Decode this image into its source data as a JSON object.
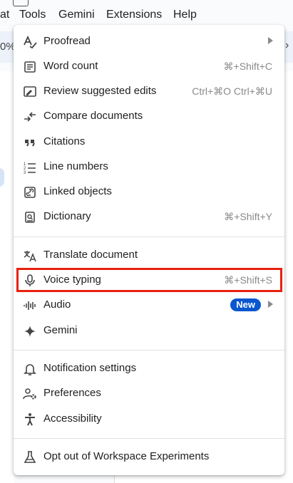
{
  "menubar": {
    "items": [
      {
        "label": "at"
      },
      {
        "label": "Tools"
      },
      {
        "label": "Gemini"
      },
      {
        "label": "Extensions"
      },
      {
        "label": "Help"
      }
    ]
  },
  "background": {
    "zoom_fragment": "0%",
    "chevron": "›"
  },
  "menu": {
    "items": [
      {
        "label": "Proofread",
        "shortcut": "",
        "icon": "proofread-icon",
        "submenu": true
      },
      {
        "label": "Word count",
        "shortcut": "⌘+Shift+C",
        "icon": "word-count-icon"
      },
      {
        "label": "Review suggested edits",
        "shortcut": "Ctrl+⌘O Ctrl+⌘U",
        "icon": "review-edits-icon"
      },
      {
        "label": "Compare documents",
        "shortcut": "",
        "icon": "compare-icon"
      },
      {
        "label": "Citations",
        "shortcut": "",
        "icon": "citations-icon"
      },
      {
        "label": "Line numbers",
        "shortcut": "",
        "icon": "line-numbers-icon"
      },
      {
        "label": "Linked objects",
        "shortcut": "",
        "icon": "linked-objects-icon"
      },
      {
        "label": "Dictionary",
        "shortcut": "⌘+Shift+Y",
        "icon": "dictionary-icon"
      },
      {
        "label": "Translate document",
        "shortcut": "",
        "icon": "translate-icon"
      },
      {
        "label": "Voice typing",
        "shortcut": "⌘+Shift+S",
        "icon": "microphone-icon"
      },
      {
        "label": "Audio",
        "badge": "New",
        "icon": "audio-icon",
        "submenu": true
      },
      {
        "label": "Gemini",
        "shortcut": "",
        "icon": "gemini-icon"
      },
      {
        "label": "Notification settings",
        "shortcut": "",
        "icon": "bell-icon"
      },
      {
        "label": "Preferences",
        "shortcut": "",
        "icon": "preferences-icon"
      },
      {
        "label": "Accessibility",
        "shortcut": "",
        "icon": "accessibility-icon"
      },
      {
        "label": "Opt out of Workspace Experiments",
        "shortcut": "",
        "icon": "flask-icon"
      }
    ]
  },
  "colors": {
    "highlight": "#e8200e",
    "badge": "#0b57d0"
  }
}
